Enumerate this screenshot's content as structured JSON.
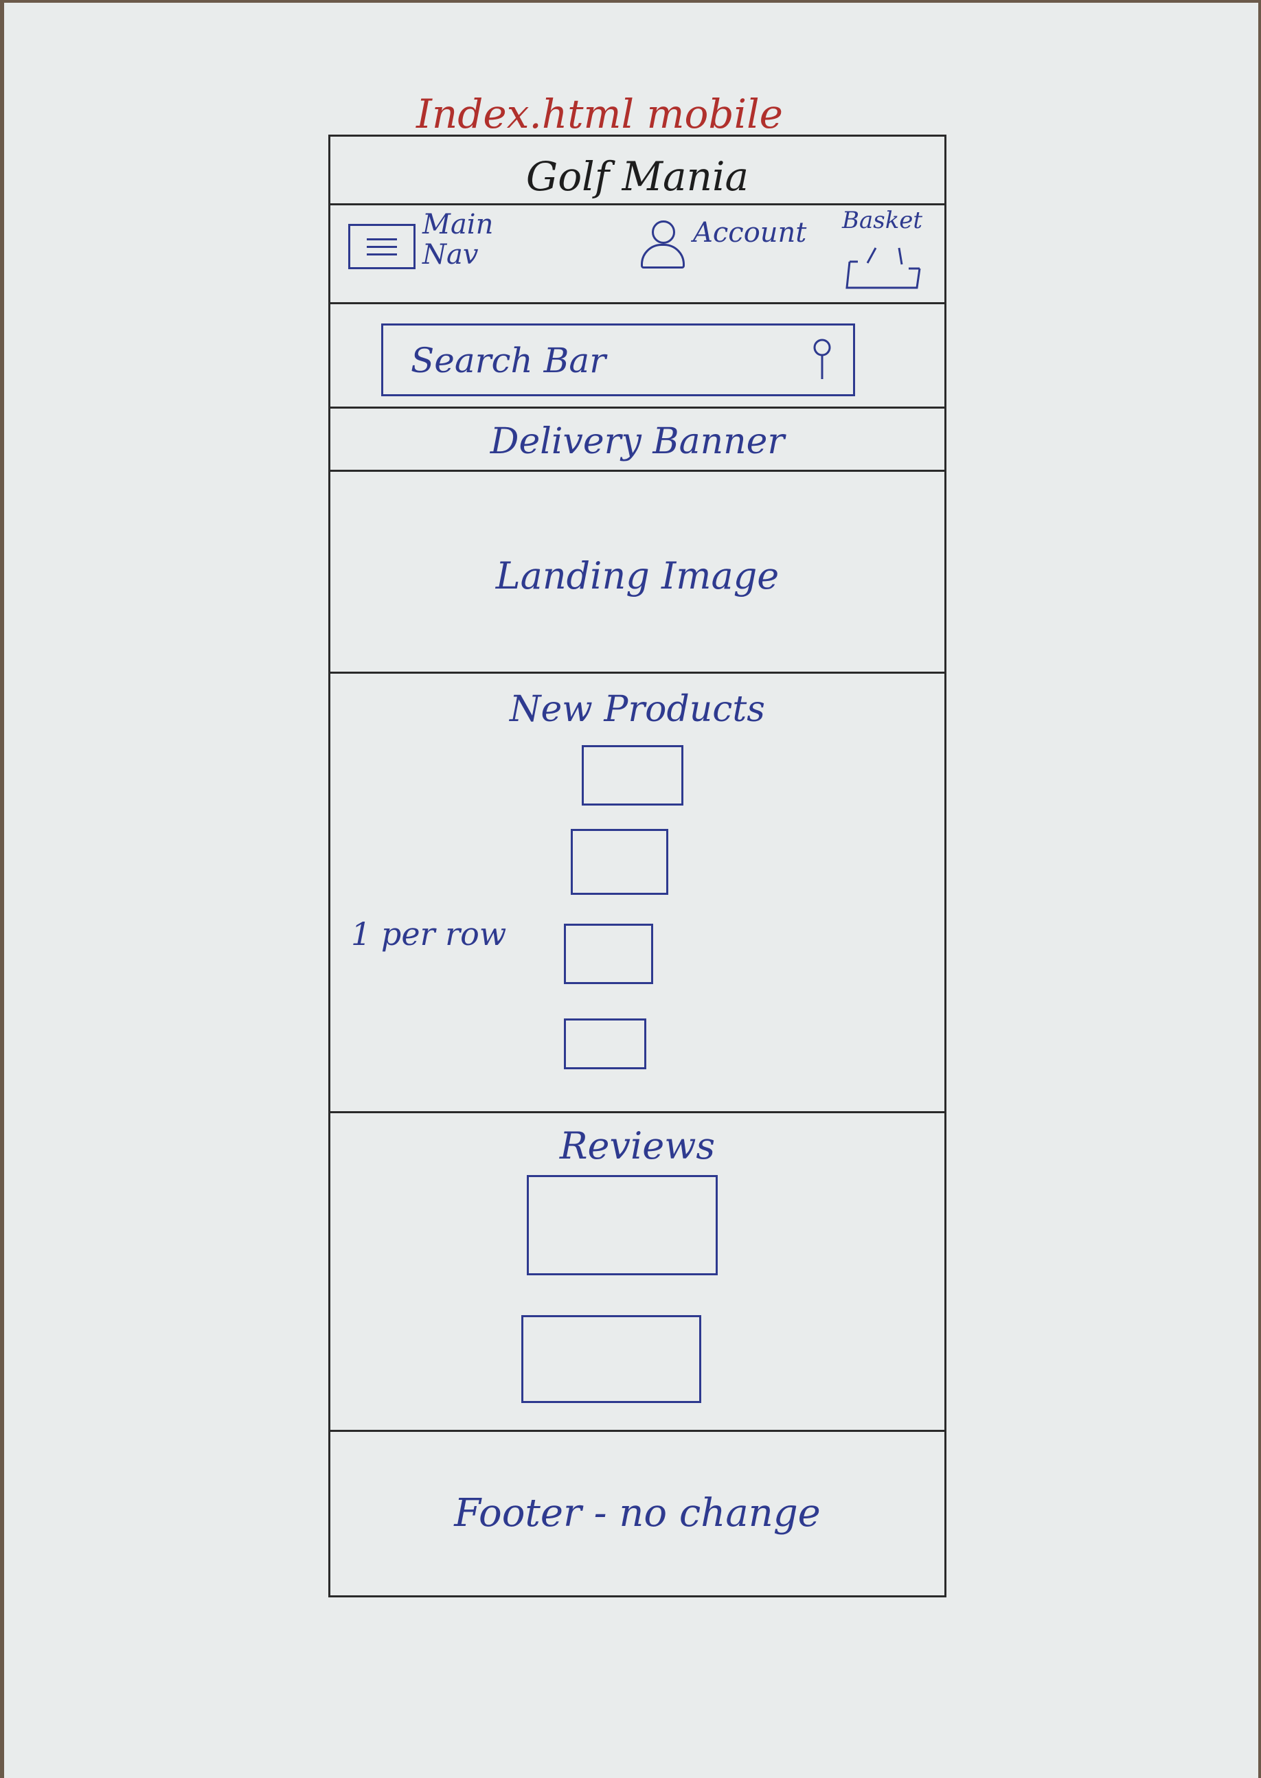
{
  "sheet": {
    "title": "Index.html mobile"
  },
  "header": {
    "brand": "Golf Mania",
    "nav": {
      "main_nav_line1": "Main",
      "main_nav_line2": "Nav",
      "account": "Account",
      "basket": "Basket"
    }
  },
  "search": {
    "label": "Search Bar"
  },
  "banner": {
    "label": "Delivery Banner"
  },
  "landing": {
    "label": "Landing Image"
  },
  "products": {
    "title": "New Products",
    "layout_note": "1 per row",
    "placeholder_count": 4
  },
  "reviews": {
    "title": "Reviews",
    "placeholder_count": 2
  },
  "footer": {
    "label": "Footer - no change"
  },
  "colors": {
    "pen_blue": "#2e3a8f",
    "title_red": "#b0302c",
    "ink_black": "#1d1d1d",
    "paper": "#e9ecec"
  },
  "icons": [
    "menu-icon",
    "account-icon",
    "basket-icon",
    "search-icon"
  ]
}
